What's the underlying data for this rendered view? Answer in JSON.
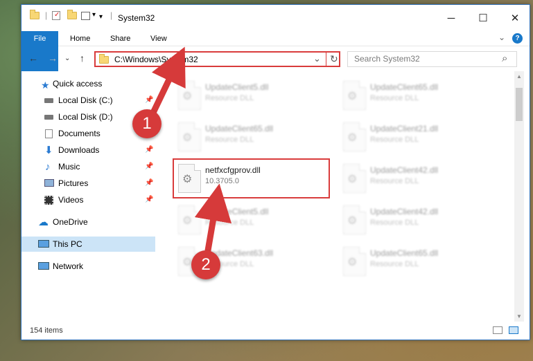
{
  "window": {
    "title": "System32"
  },
  "titlebar": {
    "minimize": "─",
    "maximize": "☐",
    "close": "✕"
  },
  "ribbon": {
    "tabs": [
      "File",
      "Home",
      "Share",
      "View"
    ],
    "help": "?",
    "expand": "⌄"
  },
  "nav": {
    "back": "←",
    "forward": "→",
    "recent": "⌄",
    "up": "↑",
    "address": "C:\\Windows\\System32",
    "dropdown": "⌄",
    "refresh": "↻",
    "search_placeholder": "Search System32",
    "search_icon": "⌕"
  },
  "sidebar": {
    "items": [
      {
        "label": "Quick access",
        "icon": "star-icon",
        "pinned": false
      },
      {
        "label": "Local Disk (C:)",
        "icon": "drive-icon",
        "pinned": true
      },
      {
        "label": "Local Disk (D:)",
        "icon": "drive-icon",
        "pinned": false
      },
      {
        "label": "Documents",
        "icon": "documents-icon",
        "pinned": true
      },
      {
        "label": "Downloads",
        "icon": "download-icon",
        "pinned": true
      },
      {
        "label": "Music",
        "icon": "music-icon",
        "pinned": true
      },
      {
        "label": "Pictures",
        "icon": "pictures-icon",
        "pinned": true
      },
      {
        "label": "Videos",
        "icon": "videos-icon",
        "pinned": true
      },
      {
        "label": "OneDrive",
        "icon": "cloud-icon",
        "pinned": false
      },
      {
        "label": "This PC",
        "icon": "computer-icon",
        "pinned": false,
        "selected": true
      },
      {
        "label": "Network",
        "icon": "network-icon",
        "pinned": false
      }
    ],
    "pin_glyph": "📌"
  },
  "files": [
    {
      "name": "UpdateClient5.dll",
      "desc": "Resource DLL",
      "blurred": true
    },
    {
      "name": "UpdateClient65.dll",
      "desc": "Resource DLL",
      "blurred": true
    },
    {
      "name": "UpdateClient65.dll",
      "desc": "Resource DLL",
      "blurred": true
    },
    {
      "name": "UpdateClient21.dll",
      "desc": "Resource DLL",
      "blurred": true
    },
    {
      "name": "netfxcfgprov.dll",
      "desc": "10.3705.0",
      "blurred": false
    },
    {
      "name": "UpdateClient42.dll",
      "desc": "Resource DLL",
      "blurred": true
    },
    {
      "name": "UpdateClient5.dll",
      "desc": "Resource DLL",
      "blurred": true
    },
    {
      "name": "UpdateClient42.dll",
      "desc": "Resource DLL",
      "blurred": true
    },
    {
      "name": "UpdateClient63.dll",
      "desc": "Resource DLL",
      "blurred": true
    },
    {
      "name": "UpdateClient65.dll",
      "desc": "Resource DLL",
      "blurred": true
    }
  ],
  "status": {
    "count": "154 items"
  },
  "markers": [
    "1",
    "2"
  ],
  "colors": {
    "accent": "#1979ca",
    "highlight": "#d93b3b"
  }
}
